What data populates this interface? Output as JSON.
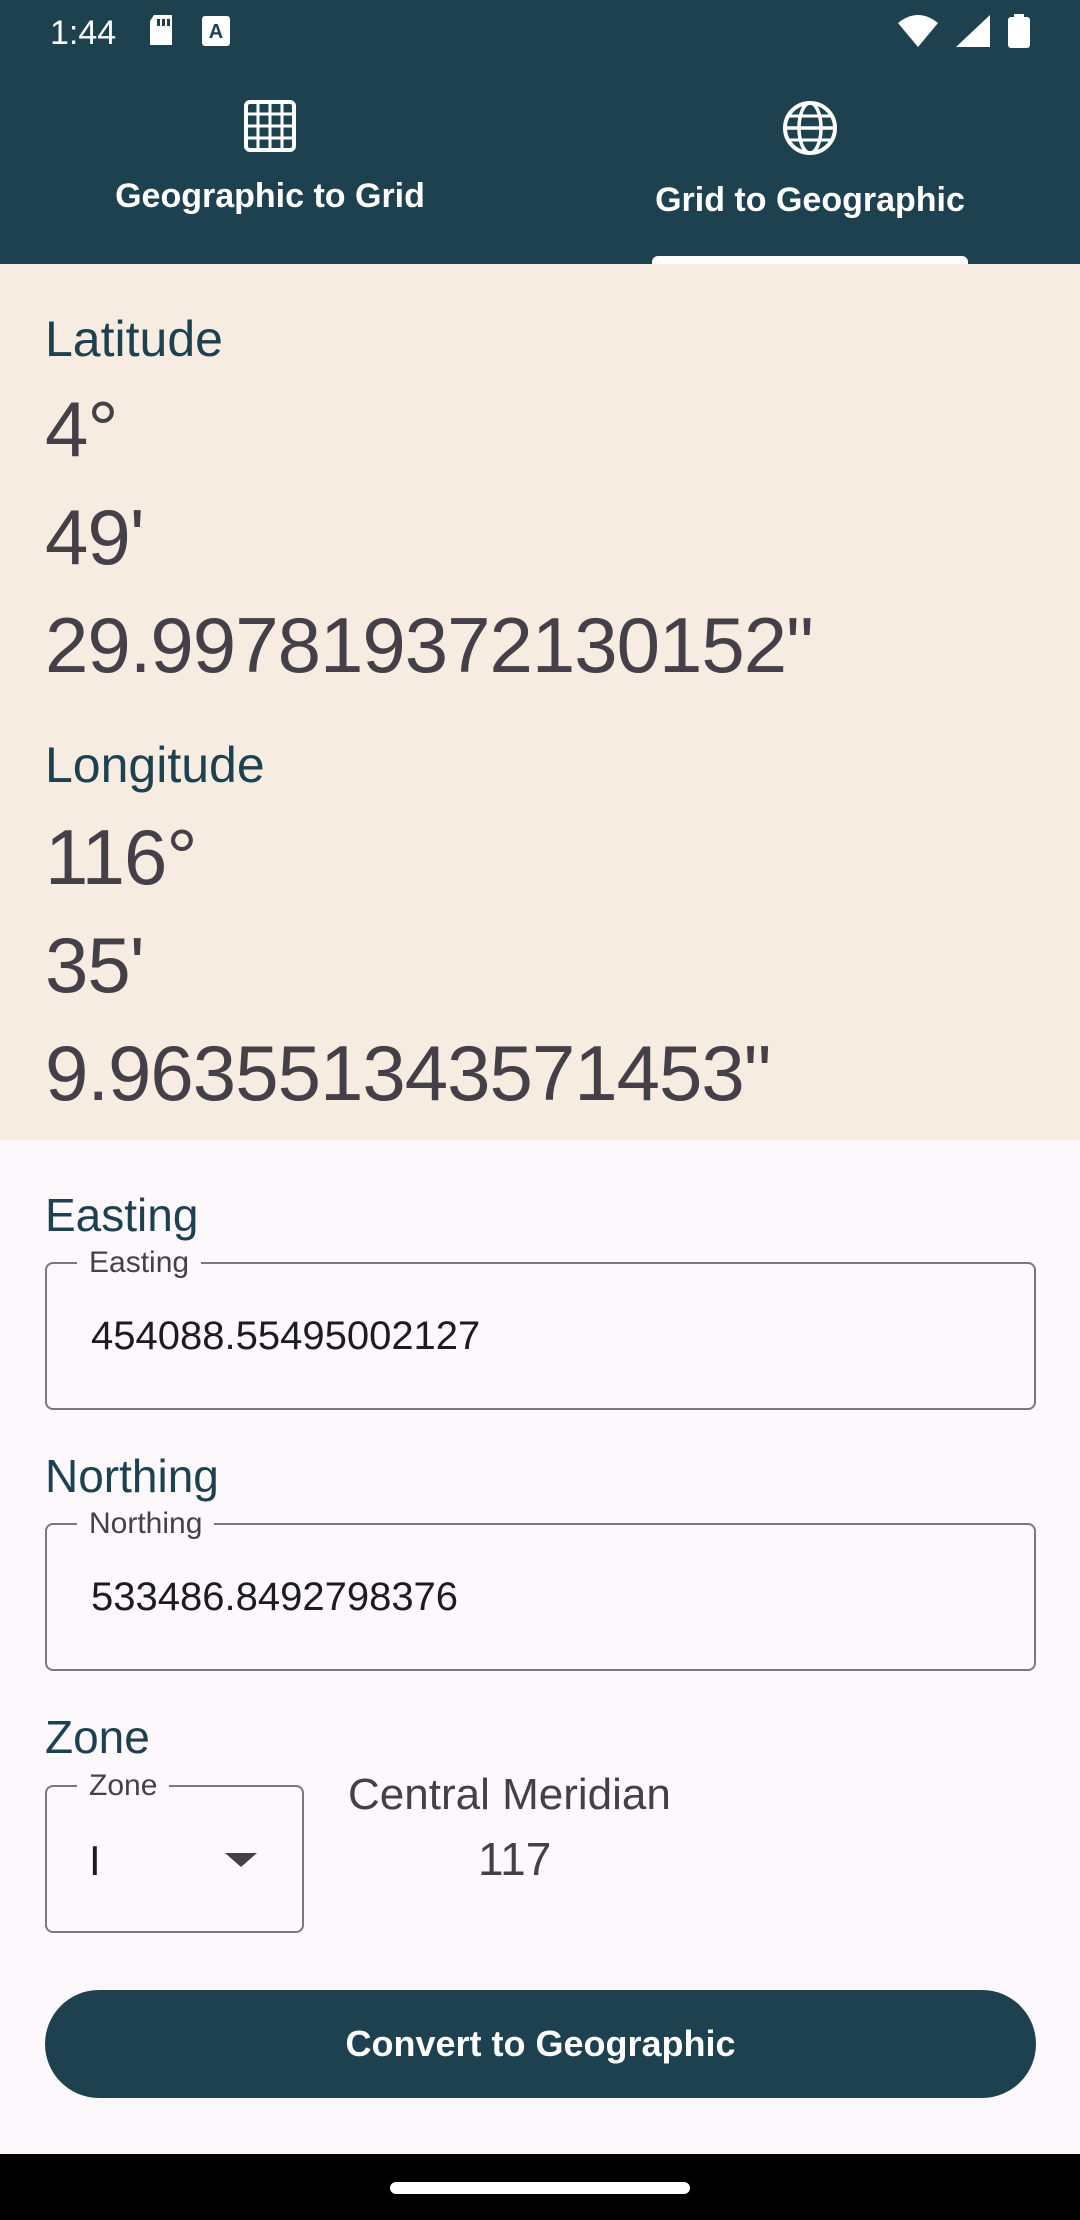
{
  "status_bar": {
    "time": "1:44",
    "left_icons": [
      "sd-card-icon",
      "text-a-icon"
    ],
    "right_icons": [
      "wifi-icon",
      "cell-signal-icon",
      "battery-icon"
    ]
  },
  "tabs": [
    {
      "label": "Geographic to Grid",
      "icon": "grid-icon",
      "selected": false
    },
    {
      "label": "Grid to Geographic",
      "icon": "globe-icon",
      "selected": true
    }
  ],
  "result": {
    "latitude_label": "Latitude",
    "latitude_degrees": "4°",
    "latitude_minutes": "49'",
    "latitude_seconds": "29.997819372130152\"",
    "longitude_label": "Longitude",
    "longitude_degrees": "116°",
    "longitude_minutes": "35'",
    "longitude_seconds": "9.963551343571453\""
  },
  "easting": {
    "section_label": "Easting",
    "field_label": "Easting",
    "value": "454088.55495002127"
  },
  "northing": {
    "section_label": "Northing",
    "field_label": "Northing",
    "value": "533486.8492798376"
  },
  "zone": {
    "section_label": "Zone",
    "field_label": "Zone",
    "value": "I",
    "central_meridian_label": "Central Meridian",
    "central_meridian_value": "117"
  },
  "actions": {
    "convert_label": "Convert to Geographic"
  },
  "colors": {
    "primary": "#1e4150",
    "result_background": "#f6ece2",
    "surface": "#fdf8fc"
  }
}
